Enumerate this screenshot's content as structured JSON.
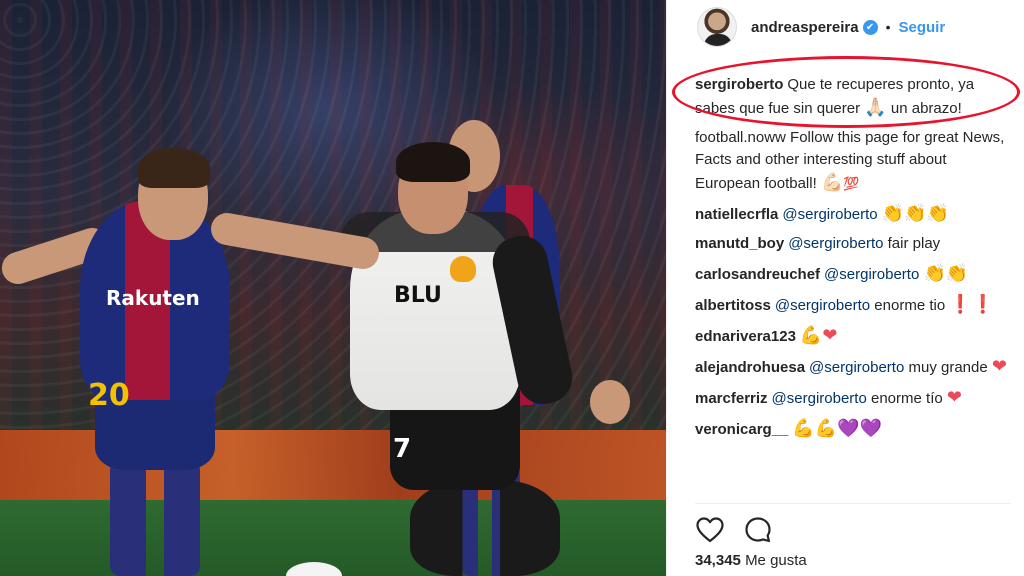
{
  "photo": {
    "sponsor_barca": "Rakuten",
    "sponsor_valencia": "BLU",
    "number_barca": "20",
    "number_valencia": "7"
  },
  "header": {
    "username": "andreaspereira",
    "verified_mark": "✔",
    "separator": "•",
    "follow_label": "Seguir"
  },
  "comments": [
    {
      "user": "sergiroberto",
      "parts": [
        {
          "t": "text",
          "v": "Que te recuperes pronto, ya sabes que fue sin querer "
        },
        {
          "t": "emoji",
          "v": "🙏🏻",
          "icon": "folded-hands-icon",
          "cls": "e-pray"
        },
        {
          "t": "text",
          "v": " un abrazo!"
        }
      ]
    },
    {
      "user": "",
      "parts": [
        {
          "t": "text",
          "v": "football.noww Follow this page for great News, Facts and other interesting stuff about European football! "
        },
        {
          "t": "emoji",
          "v": "💪🏻",
          "icon": "flexed-biceps-icon",
          "cls": "e-muscle"
        },
        {
          "t": "emoji",
          "v": "💯",
          "icon": "hundred-points-icon",
          "cls": "e-100"
        }
      ]
    },
    {
      "user": "natiellecrfla",
      "parts": [
        {
          "t": "mention",
          "v": "@sergiroberto"
        },
        {
          "t": "text",
          "v": " "
        },
        {
          "t": "emoji",
          "v": "👏👏👏",
          "icon": "clapping-hands-icon",
          "cls": "e-clap"
        }
      ]
    },
    {
      "user": "manutd_boy",
      "parts": [
        {
          "t": "mention",
          "v": "@sergiroberto"
        },
        {
          "t": "text",
          "v": " fair play"
        }
      ]
    },
    {
      "user": "carlosandreuchef",
      "parts": [
        {
          "t": "mention",
          "v": "@sergiroberto"
        },
        {
          "t": "text",
          "v": " "
        },
        {
          "t": "emoji",
          "v": "👏👏",
          "icon": "clapping-hands-icon",
          "cls": "e-clap"
        }
      ]
    },
    {
      "user": "albertitoss",
      "parts": [
        {
          "t": "mention",
          "v": "@sergiroberto"
        },
        {
          "t": "text",
          "v": " enorme tio "
        },
        {
          "t": "emoji",
          "v": "❗❗",
          "icon": "exclamation-icon",
          "cls": "e-heart"
        }
      ]
    },
    {
      "user": "ednarivera123",
      "parts": [
        {
          "t": "emoji",
          "v": "💪❤",
          "icon": "muscle-heart-icon",
          "cls": "e-heart"
        }
      ]
    },
    {
      "user": "alejandrohuesa",
      "parts": [
        {
          "t": "mention",
          "v": "@sergiroberto"
        },
        {
          "t": "text",
          "v": " muy grande "
        },
        {
          "t": "emoji",
          "v": "❤",
          "icon": "heart-icon",
          "cls": "e-heart"
        }
      ]
    },
    {
      "user": "marcferriz",
      "parts": [
        {
          "t": "mention",
          "v": "@sergiroberto"
        },
        {
          "t": "text",
          "v": " enorme tío "
        },
        {
          "t": "emoji",
          "v": "❤",
          "icon": "heart-icon",
          "cls": "e-heart"
        }
      ]
    },
    {
      "user": "veronicarg__",
      "parts": [
        {
          "t": "emoji",
          "v": "💪💪",
          "icon": "flexed-biceps-icon",
          "cls": "e-muscle"
        },
        {
          "t": "emoji",
          "v": "💜💜",
          "icon": "purple-heart-icon",
          "cls": "e-purple"
        }
      ]
    }
  ],
  "actions": {
    "like_icon": "heart-outline-icon",
    "comment_icon": "speech-bubble-icon"
  },
  "likes": {
    "count": "34,345",
    "label": "Me gusta"
  },
  "colors": {
    "accent": "#3897f0",
    "highlight_oval": "#e8142d",
    "text": "#262626"
  }
}
